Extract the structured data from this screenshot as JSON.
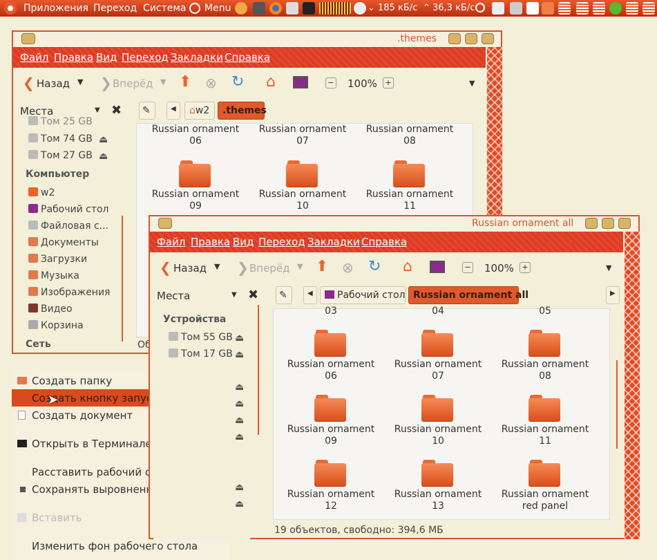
{
  "panel": {
    "apps": "Приложения",
    "places": "Переход",
    "system": "Система",
    "menu": "Menu",
    "net_down": "185 кБ/с",
    "net_up": "36,3 кБ/с"
  },
  "win1": {
    "title": ".themes",
    "menus": [
      "Файл",
      "Правка",
      "Вид",
      "Переход",
      "Закладки",
      "Справка"
    ],
    "back": "Назад",
    "forward": "Вперёд",
    "zoom": "100%",
    "places": "Места",
    "crumbs": [
      "w2",
      ".themes"
    ],
    "sidebar": {
      "vol1": "Том 74 GB",
      "vol2": "Том 27 GB",
      "vol0": "Том 25 GB",
      "computer": "Компьютер",
      "items": [
        "w2",
        "Рабочий стол",
        "Файловая с...",
        "Документы",
        "Загрузки",
        "Музыка",
        "Изображения",
        "Видео",
        "Корзина"
      ],
      "network": "Сеть"
    },
    "folders": [
      {
        "name": "Russian ornament",
        "num": "06"
      },
      {
        "name": "Russian ornament",
        "num": "07"
      },
      {
        "name": "Russian ornament",
        "num": "08"
      },
      {
        "name": "Russian ornament",
        "num": "09"
      },
      {
        "name": "Russian ornament",
        "num": "10"
      },
      {
        "name": "Russian ornament",
        "num": "11"
      }
    ],
    "status_partial": "Об"
  },
  "win2": {
    "title": "Russian ornament all",
    "menus": [
      "Файл",
      "Правка",
      "Вид",
      "Переход",
      "Закладки",
      "Справка"
    ],
    "back": "Назад",
    "forward": "Вперёд",
    "zoom": "100%",
    "places": "Места",
    "crumbs": [
      "Рабочий стол",
      "Russian ornament all"
    ],
    "sidebar": {
      "devices": "Устройства",
      "vol1": "Том 55 GB",
      "vol2": "Том 17 GB"
    },
    "top_nums": [
      "03",
      "04",
      "05"
    ],
    "folders": [
      {
        "name": "Russian ornament",
        "num": "06"
      },
      {
        "name": "Russian ornament",
        "num": "07"
      },
      {
        "name": "Russian ornament",
        "num": "08"
      },
      {
        "name": "Russian ornament",
        "num": "09"
      },
      {
        "name": "Russian ornament",
        "num": "10"
      },
      {
        "name": "Russian ornament",
        "num": "11"
      },
      {
        "name": "Russian ornament",
        "num": "12"
      },
      {
        "name": "Russian ornament",
        "num": "13"
      },
      {
        "name": "Russian ornament",
        "num": "red panel"
      }
    ],
    "status": "19 объектов, свободно: 394,6 МБ"
  },
  "context_menu": {
    "create_folder": "Создать папку",
    "create_launcher": "Создать кнопку запуска...",
    "create_document": "Создать документ",
    "open_terminal": "Открыть в Терминале",
    "arrange": "Расставить рабочий стол по имени",
    "keep_aligned": "Сохранять выровненными",
    "paste": "Вставить",
    "change_bg": "Изменить фон рабочего стола"
  },
  "colors": {
    "accent": "#d9532c",
    "panel": "#c83a16",
    "bg": "#f3efd8"
  }
}
